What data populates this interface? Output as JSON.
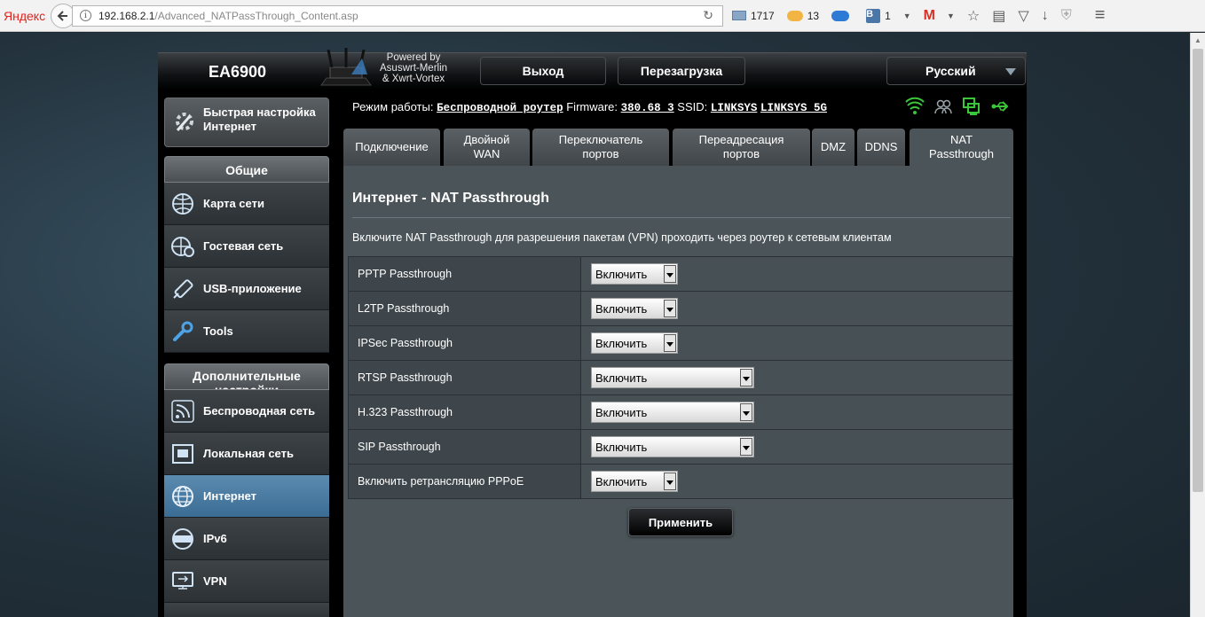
{
  "browser": {
    "brand": "Яндекс",
    "url_host": "192.168.2.1",
    "url_path": "/Advanced_NATPassThrough_Content.asp",
    "mail_count": "1717",
    "weather_temp": "13",
    "vk_count": "1"
  },
  "header": {
    "model": "EA6900",
    "powered_line1": "Powered by",
    "powered_line2": "Asuswrt-Merlin",
    "powered_line3": "& Xwrt-Vortex",
    "logout": "Выход",
    "reboot": "Перезагрузка",
    "language": "Русский"
  },
  "sidebar": {
    "quick_setup": "Быстрая настройка Интернет",
    "general_title": "Общие",
    "general_items": [
      {
        "label": "Карта сети",
        "icon": "network-map-icon"
      },
      {
        "label": "Гостевая сеть",
        "icon": "guest-network-icon"
      },
      {
        "label": "USB-приложение",
        "icon": "usb-app-icon"
      },
      {
        "label": "Tools",
        "icon": "wrench-icon"
      }
    ],
    "advanced_title": "Дополнительные настройки",
    "advanced_items": [
      {
        "label": "Беспроводная сеть",
        "icon": "wireless-icon"
      },
      {
        "label": "Локальная сеть",
        "icon": "lan-icon"
      },
      {
        "label": "Интернет",
        "icon": "globe-icon"
      },
      {
        "label": "IPv6",
        "icon": "ipv6-icon"
      },
      {
        "label": "VPN",
        "icon": "vpn-icon"
      }
    ]
  },
  "status": {
    "mode_label": "Режим работы:",
    "mode_value": "Беспроводной роутер",
    "firmware_label": "Firmware:",
    "firmware_value": "380.68_3",
    "ssid_label": "SSID:",
    "ssid_1": "LINKSYS",
    "ssid_2": "LINKSYS_5G"
  },
  "tabs": [
    {
      "label": "Подключение"
    },
    {
      "label": "Двойной WAN"
    },
    {
      "label": "Переключатель портов"
    },
    {
      "label": "Переадресация портов"
    },
    {
      "label": "DMZ"
    },
    {
      "label": "DDNS"
    },
    {
      "label": "NAT Passthrough"
    }
  ],
  "main": {
    "title": "Интернет - NAT Passthrough",
    "description": "Включите NAT Passthrough для разрешения пакетам (VPN) проходить через роутер к сетевым клиентам",
    "rows": [
      {
        "label": "PPTP Passthrough",
        "value": "Включить"
      },
      {
        "label": "L2TP Passthrough",
        "value": "Включить"
      },
      {
        "label": "IPSec Passthrough",
        "value": "Включить"
      },
      {
        "label": "RTSP Passthrough",
        "value": "Включить"
      },
      {
        "label": "H.323 Passthrough",
        "value": "Включить"
      },
      {
        "label": "SIP Passthrough",
        "value": "Включить"
      },
      {
        "label": "Включить ретрансляцию PPPoE",
        "value": "Включить"
      }
    ],
    "apply": "Применить"
  },
  "colors": {
    "accent_active": "#3b6c93",
    "status_icon_green": "#39c639"
  }
}
